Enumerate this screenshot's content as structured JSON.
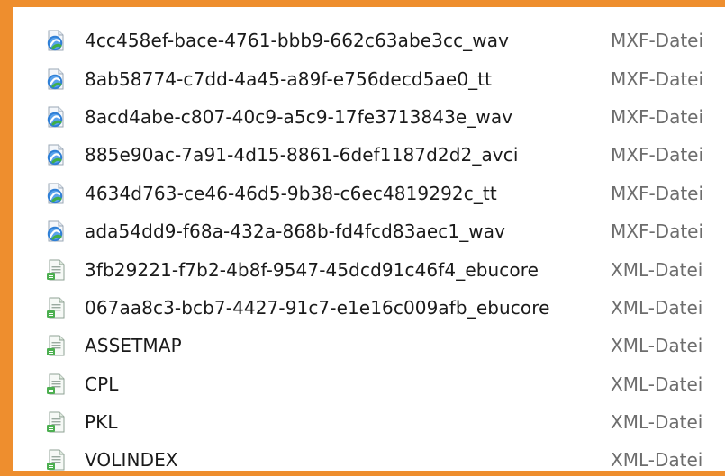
{
  "files": [
    {
      "name": "4cc458ef-bace-4761-bbb9-662c63abe3cc_wav",
      "type": "MXF-Datei",
      "icon": "mxf-media-icon"
    },
    {
      "name": "8ab58774-c7dd-4a45-a89f-e756decd5ae0_tt",
      "type": "MXF-Datei",
      "icon": "mxf-media-icon"
    },
    {
      "name": "8acd4abe-c807-40c9-a5c9-17fe3713843e_wav",
      "type": "MXF-Datei",
      "icon": "mxf-media-icon"
    },
    {
      "name": "885e90ac-7a91-4d15-8861-6def1187d2d2_avci",
      "type": "MXF-Datei",
      "icon": "mxf-media-icon"
    },
    {
      "name": "4634d763-ce46-46d5-9b38-c6ec4819292c_tt",
      "type": "MXF-Datei",
      "icon": "mxf-media-icon"
    },
    {
      "name": "ada54dd9-f68a-432a-868b-fd4fcd83aec1_wav",
      "type": "MXF-Datei",
      "icon": "mxf-media-icon"
    },
    {
      "name": "3fb29221-f7b2-4b8f-9547-45dcd91c46f4_ebucore",
      "type": "XML-Datei",
      "icon": "xml-document-icon"
    },
    {
      "name": "067aa8c3-bcb7-4427-91c7-e1e16c009afb_ebucore",
      "type": "XML-Datei",
      "icon": "xml-document-icon"
    },
    {
      "name": "ASSETMAP",
      "type": "XML-Datei",
      "icon": "xml-document-icon"
    },
    {
      "name": "CPL",
      "type": "XML-Datei",
      "icon": "xml-document-icon"
    },
    {
      "name": "PKL",
      "type": "XML-Datei",
      "icon": "xml-document-icon"
    },
    {
      "name": "VOLINDEX",
      "type": "XML-Datei",
      "icon": "xml-document-icon"
    }
  ],
  "colors": {
    "window_border": "#ee8e2e",
    "mxf_icon_blue": "#2f7fd6",
    "mxf_icon_green": "#3fae49",
    "xml_icon_green": "#4caf50"
  }
}
